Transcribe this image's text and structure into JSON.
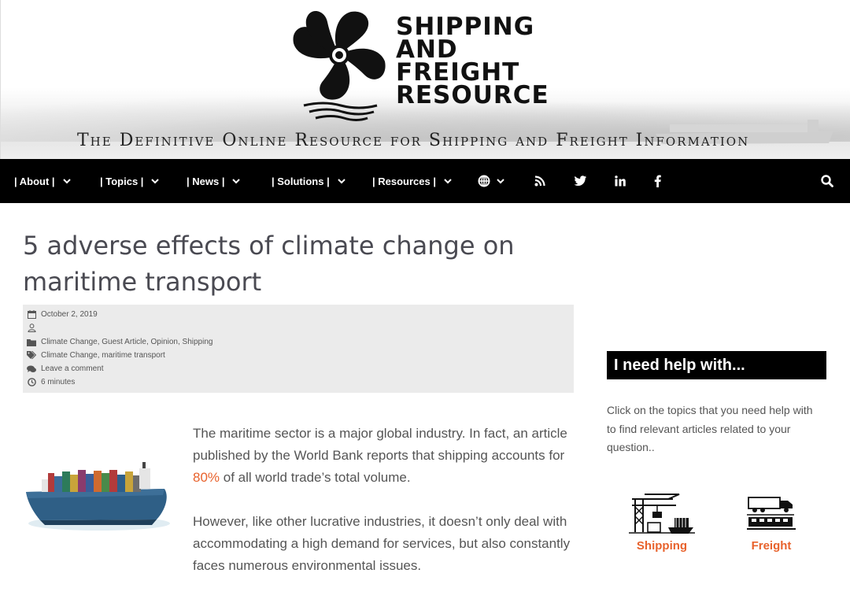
{
  "header": {
    "logo_lines": [
      "SHIPPING",
      "AND",
      "FREIGHT",
      "RESOURCE"
    ],
    "tagline": "The Definitive Online Resource for Shipping and Freight Information"
  },
  "nav": {
    "items": [
      {
        "label": "| About |"
      },
      {
        "label": "| Topics |"
      },
      {
        "label": "| News |"
      },
      {
        "label": "| Solutions |"
      },
      {
        "label": "| Resources |"
      }
    ],
    "icons": [
      "globe-icon",
      "rss-icon",
      "twitter-icon",
      "linkedin-icon",
      "facebook-icon",
      "search-icon"
    ]
  },
  "article": {
    "title": "5 adverse effects of climate change on maritime transport",
    "meta": {
      "date": "October 2, 2019",
      "author": "",
      "categories": "Climate Change, Guest Article, Opinion, Shipping",
      "tags": "Climate Change, maritime transport",
      "comments": "Leave a comment",
      "read_time": "6 minutes"
    },
    "p1_before": "The maritime sector is a major global industry. In fact, an article published by the World Bank reports that shipping accounts for ",
    "p1_highlight": "80%",
    "p1_after": " of all world trade’s total volume.",
    "p2": "However, like other lucrative industries, it doesn’t only deal with accommodating a high demand for services, but also constantly faces numerous environmental issues."
  },
  "sidebar": {
    "title": "I need help with...",
    "description": "Click on the topics that you need help with to find relevant articles related to your question..",
    "topics": [
      {
        "label": "Shipping",
        "icon": "port-crane-icon"
      },
      {
        "label": "Freight",
        "icon": "truck-train-icon"
      }
    ]
  },
  "colors": {
    "accent": "#e8622c",
    "nav_bg": "#000000",
    "meta_bg": "#ebebeb",
    "title": "#4a4a52"
  }
}
